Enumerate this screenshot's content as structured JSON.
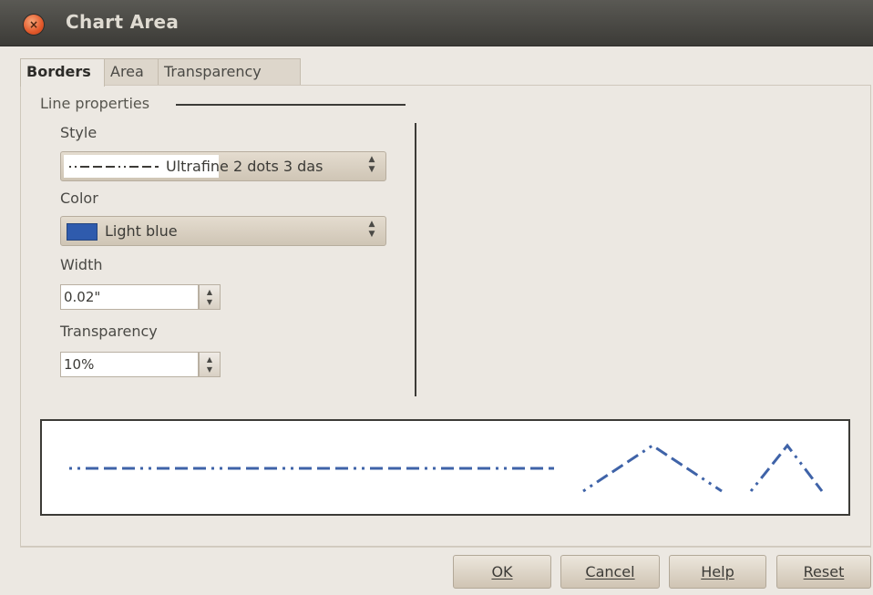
{
  "window": {
    "title": "Chart Area",
    "close_icon": "close-icon",
    "close_glyph": "×"
  },
  "tabs": [
    {
      "label": "Borders",
      "active": true
    },
    {
      "label": "Area",
      "active": false
    },
    {
      "label": "Transparency",
      "active": false
    }
  ],
  "line_properties": {
    "group_label": "Line properties",
    "style": {
      "label": "Style",
      "value": "Ultrafine 2 dots 3 das"
    },
    "color": {
      "label": "Color",
      "value": "Light blue",
      "swatch": "#2f5bad"
    },
    "width": {
      "label": "Width",
      "value": "0.02\""
    },
    "transparency": {
      "label": "Transparency",
      "value": "10%"
    }
  },
  "preview": {
    "line_color": "#3f63a8"
  },
  "buttons": {
    "ok": "OK",
    "cancel": "Cancel",
    "help": "Help",
    "reset": "Reset"
  }
}
